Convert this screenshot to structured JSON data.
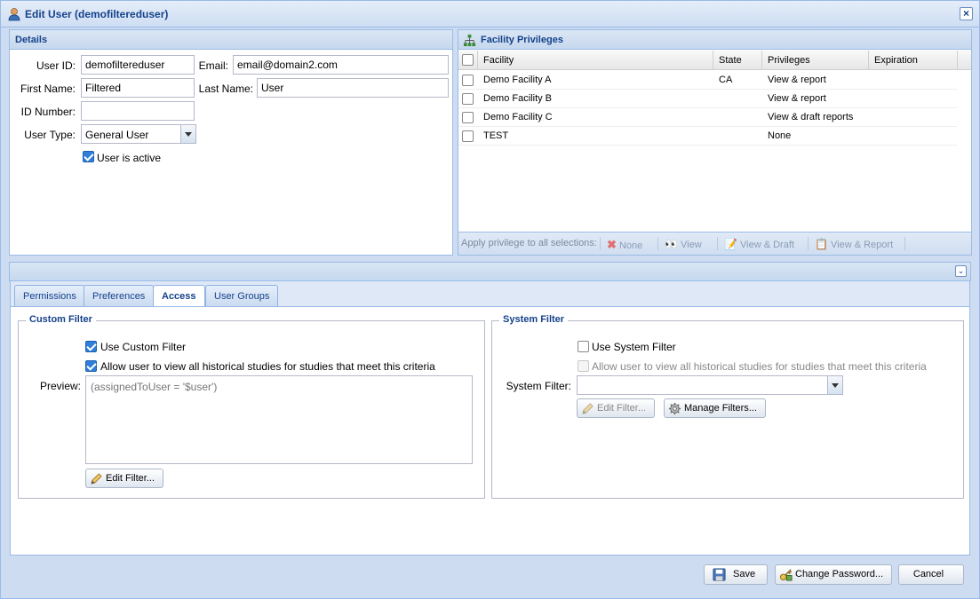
{
  "window": {
    "title": "Edit User (demofiltereduser)"
  },
  "details": {
    "header": "Details",
    "user_id_label": "User ID:",
    "user_id": "demofiltereduser",
    "email_label": "Email:",
    "email": "email@domain2.com",
    "first_name_label": "First Name:",
    "first_name": "Filtered",
    "last_name_label": "Last Name:",
    "last_name": "User",
    "id_number_label": "ID Number:",
    "id_number": "",
    "user_type_label": "User Type:",
    "user_type": "General User",
    "active_label": "User is active",
    "active_checked": true
  },
  "facility": {
    "header": "Facility Privileges",
    "columns": [
      "Facility",
      "State",
      "Privileges",
      "Expiration"
    ],
    "rows": [
      {
        "facility": "Demo Facility A",
        "state": "CA",
        "privileges": "View & report",
        "expiration": ""
      },
      {
        "facility": "Demo Facility B",
        "state": "",
        "privileges": "View & report",
        "expiration": ""
      },
      {
        "facility": "Demo Facility C",
        "state": "",
        "privileges": "View & draft reports",
        "expiration": ""
      },
      {
        "facility": "TEST",
        "state": "",
        "privileges": "None",
        "expiration": ""
      }
    ],
    "toolbar": {
      "apply_label": "Apply privilege to all selections:",
      "none": "None",
      "view": "View",
      "view_draft": "View & Draft",
      "view_report": "View & Report"
    }
  },
  "tabs": [
    {
      "label": "Permissions",
      "active": false
    },
    {
      "label": "Preferences",
      "active": false
    },
    {
      "label": "Access",
      "active": true
    },
    {
      "label": "User Groups",
      "active": false
    }
  ],
  "custom_filter": {
    "legend": "Custom Filter",
    "use_label": "Use Custom Filter",
    "use_checked": true,
    "historical_label": "Allow user to view all historical studies for studies that meet this criteria",
    "historical_checked": true,
    "preview_label": "Preview:",
    "preview_value": "(assignedToUser = '$user')",
    "edit_button": "Edit Filter..."
  },
  "system_filter": {
    "legend": "System Filter",
    "use_label": "Use System Filter",
    "use_checked": false,
    "historical_label": "Allow user to view all historical studies for studies that meet this criteria",
    "historical_checked": false,
    "filter_label": "System Filter:",
    "filter_value": "",
    "edit_button": "Edit Filter...",
    "manage_button": "Manage Filters..."
  },
  "footer": {
    "save": "Save",
    "change_password": "Change Password...",
    "cancel": "Cancel"
  },
  "colors": {
    "accent": "#15428b",
    "border": "#99bbe8",
    "header_bg": "#cfdef3"
  }
}
